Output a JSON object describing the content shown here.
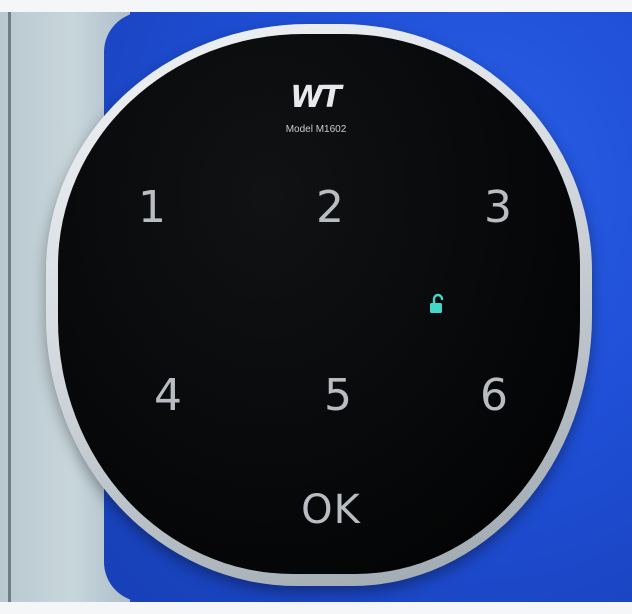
{
  "brand": {
    "logo": "WT",
    "model": "Model M1602"
  },
  "keypad": {
    "keys": [
      "1",
      "2",
      "3",
      "4",
      "5",
      "6"
    ],
    "ok": "OK"
  },
  "indicator": {
    "icon": "unlocked-padlock-icon",
    "color": "#46d6c8"
  },
  "colors": {
    "door_blue": "#1f4fd6",
    "face_black": "#050607",
    "key_gray": "#b9bcc0"
  }
}
